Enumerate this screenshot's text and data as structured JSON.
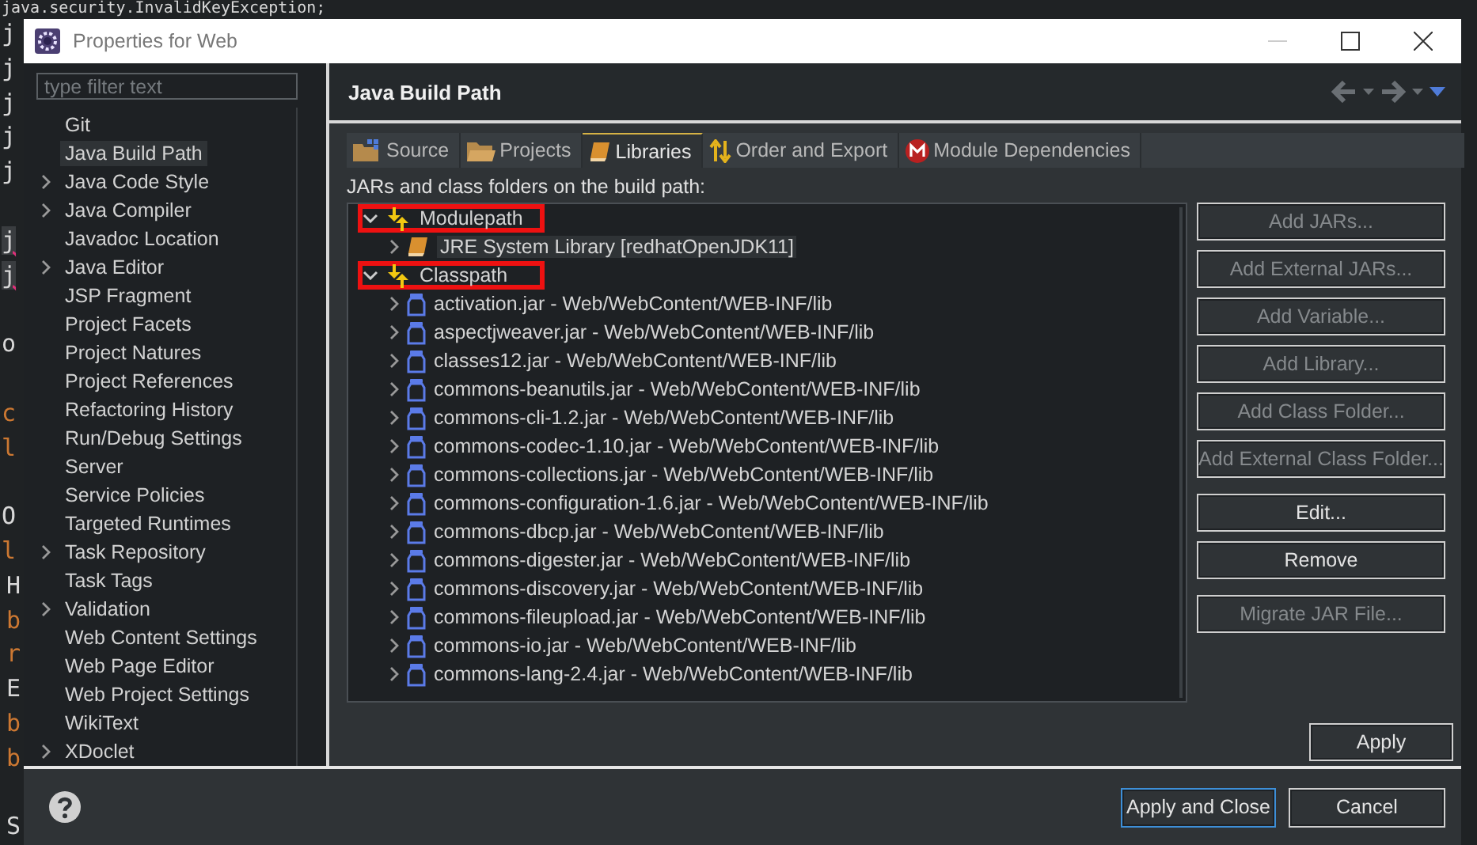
{
  "editor": {
    "lines": [
      {
        "text": "java.security.InvalidKeyException;",
        "kind": "top"
      },
      {
        "text": "j",
        "kind": "plain"
      },
      {
        "text": "j",
        "kind": "plain"
      },
      {
        "text": "j",
        "kind": "plain"
      },
      {
        "text": "j",
        "kind": "plain"
      },
      {
        "text": "j",
        "kind": "plain"
      },
      {
        "kind": "blank"
      },
      {
        "text": "j",
        "kind": "error"
      },
      {
        "text": "j",
        "kind": "error"
      },
      {
        "kind": "blank"
      },
      {
        "text": "o",
        "kind": "plain"
      },
      {
        "kind": "blank"
      },
      {
        "text": "c",
        "kind": "keyword"
      },
      {
        "text": "l",
        "kind": "keyword"
      },
      {
        "kind": "blank"
      },
      {
        "text": "O",
        "kind": "plain"
      },
      {
        "text": "l",
        "kind": "keyword"
      },
      {
        "text": "H",
        "kind": "plain-indented"
      },
      {
        "text": "b",
        "kind": "keyword-indented"
      },
      {
        "text": "r",
        "kind": "keyword-indented"
      },
      {
        "text": "E",
        "kind": "plain-indented"
      },
      {
        "text": "b",
        "kind": "keyword-indented"
      },
      {
        "text": "b",
        "kind": "keyword-indented"
      },
      {
        "kind": "blank"
      },
      {
        "text": "S",
        "kind": "plain-indented"
      }
    ]
  },
  "window": {
    "title": "Properties for Web"
  },
  "sidebar": {
    "filter": {
      "placeholder": "type filter text"
    },
    "items": [
      {
        "label": "Git",
        "expandable": false,
        "selected": false
      },
      {
        "label": "Java Build Path",
        "expandable": false,
        "selected": true
      },
      {
        "label": "Java Code Style",
        "expandable": true,
        "selected": false
      },
      {
        "label": "Java Compiler",
        "expandable": true,
        "selected": false
      },
      {
        "label": "Javadoc Location",
        "expandable": false,
        "selected": false
      },
      {
        "label": "Java Editor",
        "expandable": true,
        "selected": false
      },
      {
        "label": "JSP Fragment",
        "expandable": false,
        "selected": false
      },
      {
        "label": "Project Facets",
        "expandable": false,
        "selected": false
      },
      {
        "label": "Project Natures",
        "expandable": false,
        "selected": false
      },
      {
        "label": "Project References",
        "expandable": false,
        "selected": false
      },
      {
        "label": "Refactoring History",
        "expandable": false,
        "selected": false
      },
      {
        "label": "Run/Debug Settings",
        "expandable": false,
        "selected": false
      },
      {
        "label": "Server",
        "expandable": false,
        "selected": false
      },
      {
        "label": "Service Policies",
        "expandable": false,
        "selected": false
      },
      {
        "label": "Targeted Runtimes",
        "expandable": false,
        "selected": false
      },
      {
        "label": "Task Repository",
        "expandable": true,
        "selected": false
      },
      {
        "label": "Task Tags",
        "expandable": false,
        "selected": false
      },
      {
        "label": "Validation",
        "expandable": true,
        "selected": false
      },
      {
        "label": "Web Content Settings",
        "expandable": false,
        "selected": false
      },
      {
        "label": "Web Page Editor",
        "expandable": false,
        "selected": false
      },
      {
        "label": "Web Project Settings",
        "expandable": false,
        "selected": false
      },
      {
        "label": "WikiText",
        "expandable": false,
        "selected": false
      },
      {
        "label": "XDoclet",
        "expandable": true,
        "selected": false
      }
    ]
  },
  "page": {
    "title": "Java Build Path",
    "tabs": [
      {
        "label": "Source",
        "kind": "source",
        "selected": false
      },
      {
        "label": "Projects",
        "kind": "projects",
        "selected": false
      },
      {
        "label": "Libraries",
        "kind": "libraries",
        "selected": true
      },
      {
        "label": "Order and Export",
        "kind": "order",
        "selected": false
      },
      {
        "label": "Module Dependencies",
        "kind": "module",
        "selected": false
      }
    ],
    "tree_label": "JARs and class folders on the build path:",
    "tree": [
      {
        "label": "Modulepath",
        "kind": "container",
        "expanded": true,
        "highlighted": true,
        "children": [
          {
            "label": "JRE System Library [redhatOpenJDK11]",
            "kind": "library",
            "expanded": false,
            "highlighted": false
          }
        ]
      },
      {
        "label": "Classpath",
        "kind": "container",
        "expanded": true,
        "highlighted": true,
        "children": [
          {
            "label": "activation.jar - Web/WebContent/WEB-INF/lib",
            "kind": "jar",
            "expanded": false,
            "highlighted": false
          },
          {
            "label": "aspectjweaver.jar - Web/WebContent/WEB-INF/lib",
            "kind": "jar",
            "expanded": false,
            "highlighted": false
          },
          {
            "label": "classes12.jar - Web/WebContent/WEB-INF/lib",
            "kind": "jar",
            "expanded": false,
            "highlighted": false
          },
          {
            "label": "commons-beanutils.jar - Web/WebContent/WEB-INF/lib",
            "kind": "jar",
            "expanded": false,
            "highlighted": false
          },
          {
            "label": "commons-cli-1.2.jar - Web/WebContent/WEB-INF/lib",
            "kind": "jar",
            "expanded": false,
            "highlighted": false
          },
          {
            "label": "commons-codec-1.10.jar - Web/WebContent/WEB-INF/lib",
            "kind": "jar",
            "expanded": false,
            "highlighted": false
          },
          {
            "label": "commons-collections.jar - Web/WebContent/WEB-INF/lib",
            "kind": "jar",
            "expanded": false,
            "highlighted": false
          },
          {
            "label": "commons-configuration-1.6.jar - Web/WebContent/WEB-INF/lib",
            "kind": "jar",
            "expanded": false,
            "highlighted": false
          },
          {
            "label": "commons-dbcp.jar - Web/WebContent/WEB-INF/lib",
            "kind": "jar",
            "expanded": false,
            "highlighted": false
          },
          {
            "label": "commons-digester.jar - Web/WebContent/WEB-INF/lib",
            "kind": "jar",
            "expanded": false,
            "highlighted": false
          },
          {
            "label": "commons-discovery.jar - Web/WebContent/WEB-INF/lib",
            "kind": "jar",
            "expanded": false,
            "highlighted": false
          },
          {
            "label": "commons-fileupload.jar - Web/WebContent/WEB-INF/lib",
            "kind": "jar",
            "expanded": false,
            "highlighted": false
          },
          {
            "label": "commons-io.jar - Web/WebContent/WEB-INF/lib",
            "kind": "jar",
            "expanded": false,
            "highlighted": false
          },
          {
            "label": "commons-lang-2.4.jar - Web/WebContent/WEB-INF/lib",
            "kind": "jar",
            "expanded": false,
            "highlighted": false
          }
        ]
      }
    ],
    "button_groups": [
      [
        {
          "label": "Add JARs...",
          "disabled": true
        },
        {
          "label": "Add External JARs...",
          "disabled": true
        },
        {
          "label": "Add Variable...",
          "disabled": true
        },
        {
          "label": "Add Library...",
          "disabled": true
        },
        {
          "label": "Add Class Folder...",
          "disabled": true
        },
        {
          "label": "Add External Class Folder...",
          "disabled": true
        }
      ],
      [
        {
          "label": "Edit...",
          "disabled": false
        },
        {
          "label": "Remove",
          "disabled": false
        }
      ],
      [
        {
          "label": "Migrate JAR File...",
          "disabled": true
        }
      ]
    ],
    "apply": "Apply"
  },
  "footer": {
    "buttons": [
      {
        "label": "Apply and Close",
        "default": true
      },
      {
        "label": "Cancel",
        "default": false
      }
    ]
  }
}
